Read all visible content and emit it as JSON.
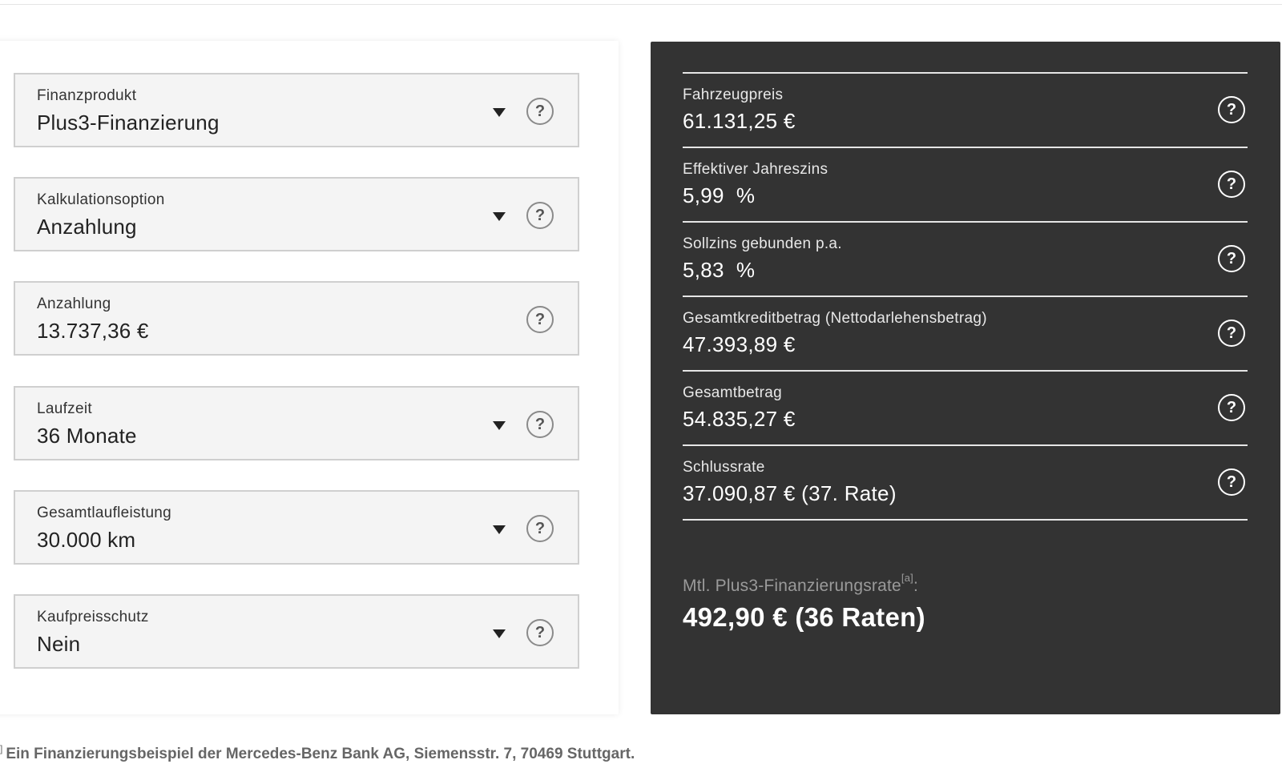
{
  "fields": [
    {
      "label": "Finanzprodukt",
      "value": "Plus3-Finanzierung",
      "dropdown": true
    },
    {
      "label": "Kalkulationsoption",
      "value": "Anzahlung",
      "dropdown": true
    },
    {
      "label": "Anzahlung",
      "value": "13.737,36 €",
      "dropdown": false
    },
    {
      "label": "Laufzeit",
      "value": "36 Monate",
      "dropdown": true
    },
    {
      "label": "Gesamtlaufleistung",
      "value": "30.000 km",
      "dropdown": true
    },
    {
      "label": "Kaufpreisschutz",
      "value": "Nein",
      "dropdown": true
    }
  ],
  "help_glyph": "?",
  "summary": [
    {
      "label": "Fahrzeugpreis",
      "value": "61.131,25 €"
    },
    {
      "label": "Effektiver Jahreszins",
      "value": "5,99  %"
    },
    {
      "label": "Sollzins gebunden p.a.",
      "value": "5,83  %"
    },
    {
      "label": "Gesamtkreditbetrag (Nettodarlehensbetrag)",
      "value": "47.393,89 €"
    },
    {
      "label": "Gesamtbetrag",
      "value": "54.835,27 €"
    },
    {
      "label": "Schlussrate",
      "value": "37.090,87 € (37. Rate)"
    }
  ],
  "monthly": {
    "label": "Mtl. Plus3-Finanzierungsrate",
    "footnote_ref": "[a]",
    "suffix": ":",
    "value": "492,90 € (36 Raten)"
  },
  "footnote": {
    "mark": "]",
    "text": "Ein Finanzierungsbeispiel der Mercedes-Benz Bank AG, Siemensstr. 7, 70469 Stuttgart."
  },
  "colors": {
    "dark_panel": "#333333",
    "field_bg": "#f4f4f4",
    "field_border": "#cfcfcf"
  },
  "icons": {
    "dropdown": "caret-down-icon",
    "help": "question-circle-icon"
  }
}
